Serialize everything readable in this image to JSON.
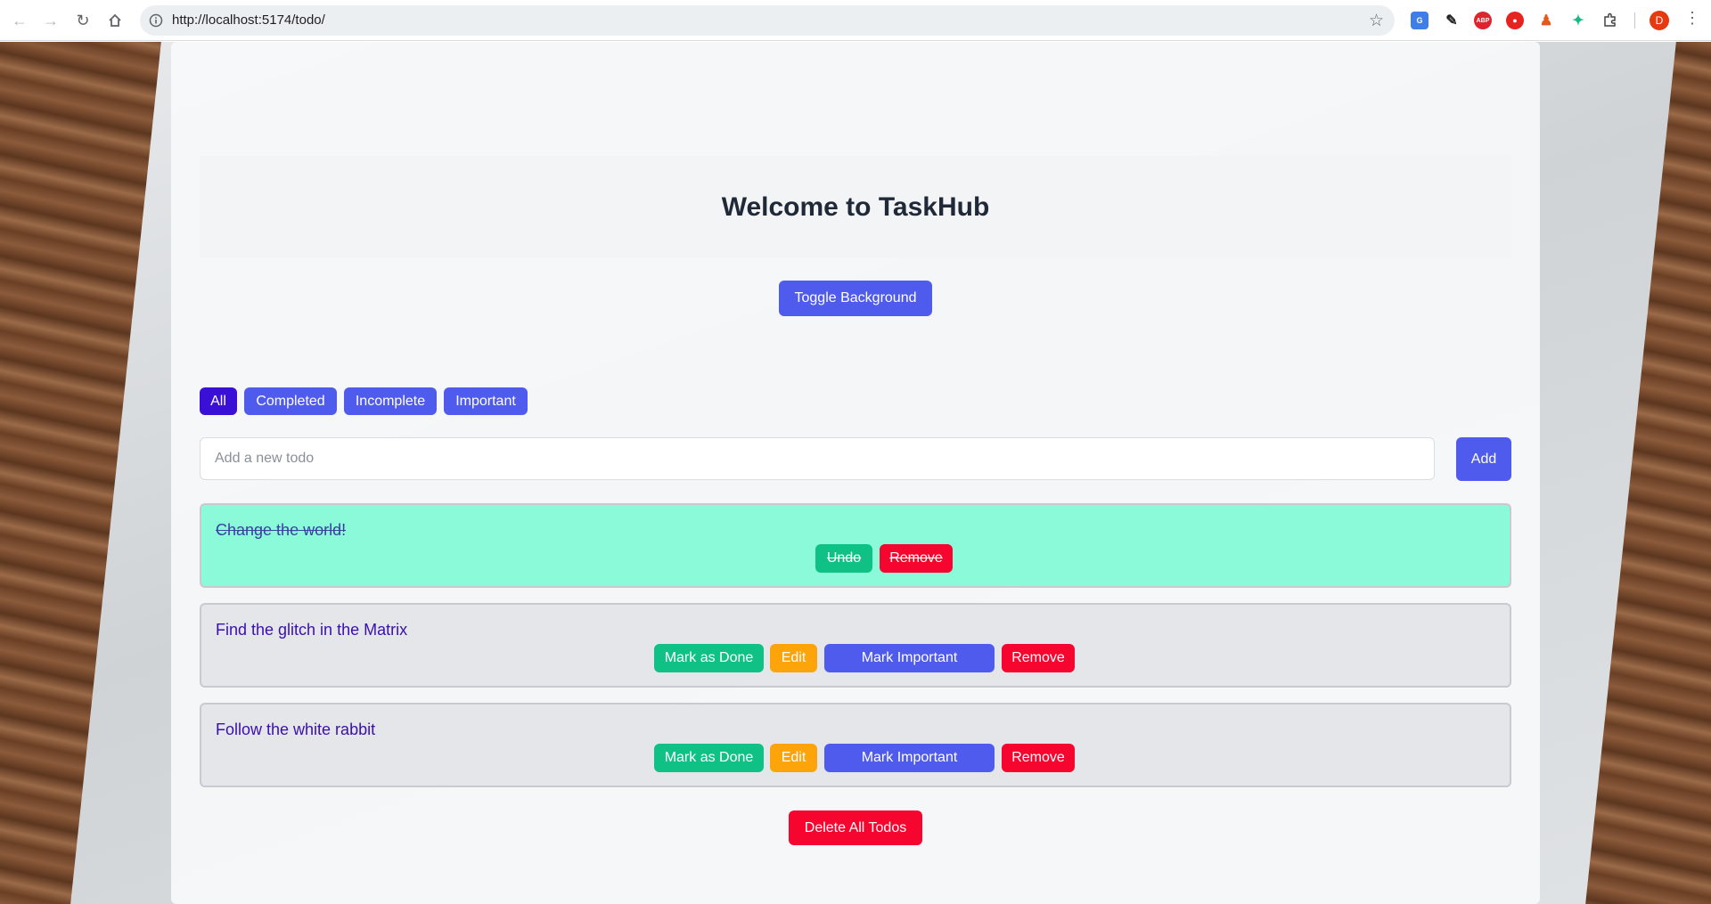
{
  "browser": {
    "url": "http://localhost:5174/todo/",
    "profile_initial": "D",
    "extensions": [
      "translate-icon",
      "eyedropper-icon",
      "adblock-icon",
      "shield-icon",
      "figure-icon",
      "sparkle-icon",
      "puzzle-icon"
    ]
  },
  "header": {
    "title": "Welcome to TaskHub"
  },
  "toggle_background_label": "Toggle Background",
  "filters": {
    "items": [
      "All",
      "Completed",
      "Incomplete",
      "Important"
    ],
    "active": "All"
  },
  "new_todo": {
    "placeholder": "Add a new todo",
    "value": "",
    "add_label": "Add"
  },
  "todos": [
    {
      "text": "Change the world!",
      "completed": true,
      "actions": {
        "undo": "Undo",
        "remove": "Remove"
      }
    },
    {
      "text": "Find the glitch in the Matrix",
      "completed": false,
      "actions": {
        "done": "Mark as Done",
        "edit": "Edit",
        "important": "Mark Important",
        "remove": "Remove"
      }
    },
    {
      "text": "Follow the white rabbit",
      "completed": false,
      "actions": {
        "done": "Mark as Done",
        "edit": "Edit",
        "important": "Mark Important",
        "remove": "Remove"
      }
    }
  ],
  "delete_all_label": "Delete All Todos",
  "colors": {
    "primary": "#4f5bed",
    "active_filter": "#3a0fd6",
    "done": "#0fc184",
    "edit": "#fca409",
    "danger": "#f6052e",
    "completed_row": "#8bfad8"
  }
}
